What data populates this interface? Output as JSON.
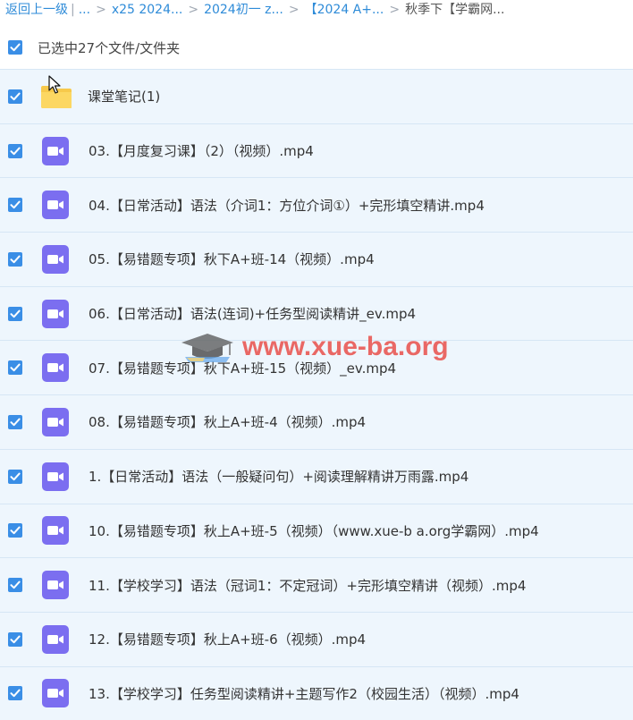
{
  "breadcrumb": {
    "back_label": "返回上一级",
    "crumbs": [
      "...",
      "x25 2024...",
      "2024初一 z...",
      "【2024 A+..."
    ],
    "current": "秋季下【学霸网..."
  },
  "selection": {
    "text": "已选中27个文件/文件夹",
    "checked": true
  },
  "watermark": {
    "text": "www.xue-ba.org"
  },
  "colors": {
    "accent": "#3a8ee6",
    "link": "#2e8bd8",
    "row_bg": "#eef6fd",
    "folder": "#f7c94b",
    "video_icon": "#7b6ef0",
    "watermark": "#e8413b"
  },
  "files": [
    {
      "name": "课堂笔记(1)",
      "type": "folder",
      "icon": "folder-icon",
      "checked": true
    },
    {
      "name": "03.【月度复习课】（2）（视频）.mp4",
      "type": "video",
      "icon": "video-file-icon",
      "checked": true
    },
    {
      "name": "04.【日常活动】语法（介词1：方位介词①）+完形填空精讲.mp4",
      "type": "video",
      "icon": "video-file-icon",
      "checked": true
    },
    {
      "name": "05.【易错题专项】秋下A+班-14（视频）.mp4",
      "type": "video",
      "icon": "video-file-icon",
      "checked": true
    },
    {
      "name": "06.【日常活动】语法(连词)+任务型阅读精讲_ev.mp4",
      "type": "video",
      "icon": "video-file-icon",
      "checked": true
    },
    {
      "name": "07.【易错题专项】秋下A+班-15（视频）_ev.mp4",
      "type": "video",
      "icon": "video-file-icon",
      "checked": true
    },
    {
      "name": "08.【易错题专项】秋上A+班-4（视频）.mp4",
      "type": "video",
      "icon": "video-file-icon",
      "checked": true
    },
    {
      "name": "1.【日常活动】语法（一般疑问句）+阅读理解精讲万雨露.mp4",
      "type": "video",
      "icon": "video-file-icon",
      "checked": true
    },
    {
      "name": "10.【易错题专项】秋上A+班-5（视频）（www.xue-b a.org学霸网）.mp4",
      "type": "video",
      "icon": "video-file-icon",
      "checked": true
    },
    {
      "name": "11.【学校学习】语法（冠词1：不定冠词）+完形填空精讲（视频）.mp4",
      "type": "video",
      "icon": "video-file-icon",
      "checked": true
    },
    {
      "name": "12.【易错题专项】秋上A+班-6（视频）.mp4",
      "type": "video",
      "icon": "video-file-icon",
      "checked": true
    },
    {
      "name": "13.【学校学习】任务型阅读精讲+主题写作2（校园生活）（视频）.mp4",
      "type": "video",
      "icon": "video-file-icon",
      "checked": true
    }
  ]
}
